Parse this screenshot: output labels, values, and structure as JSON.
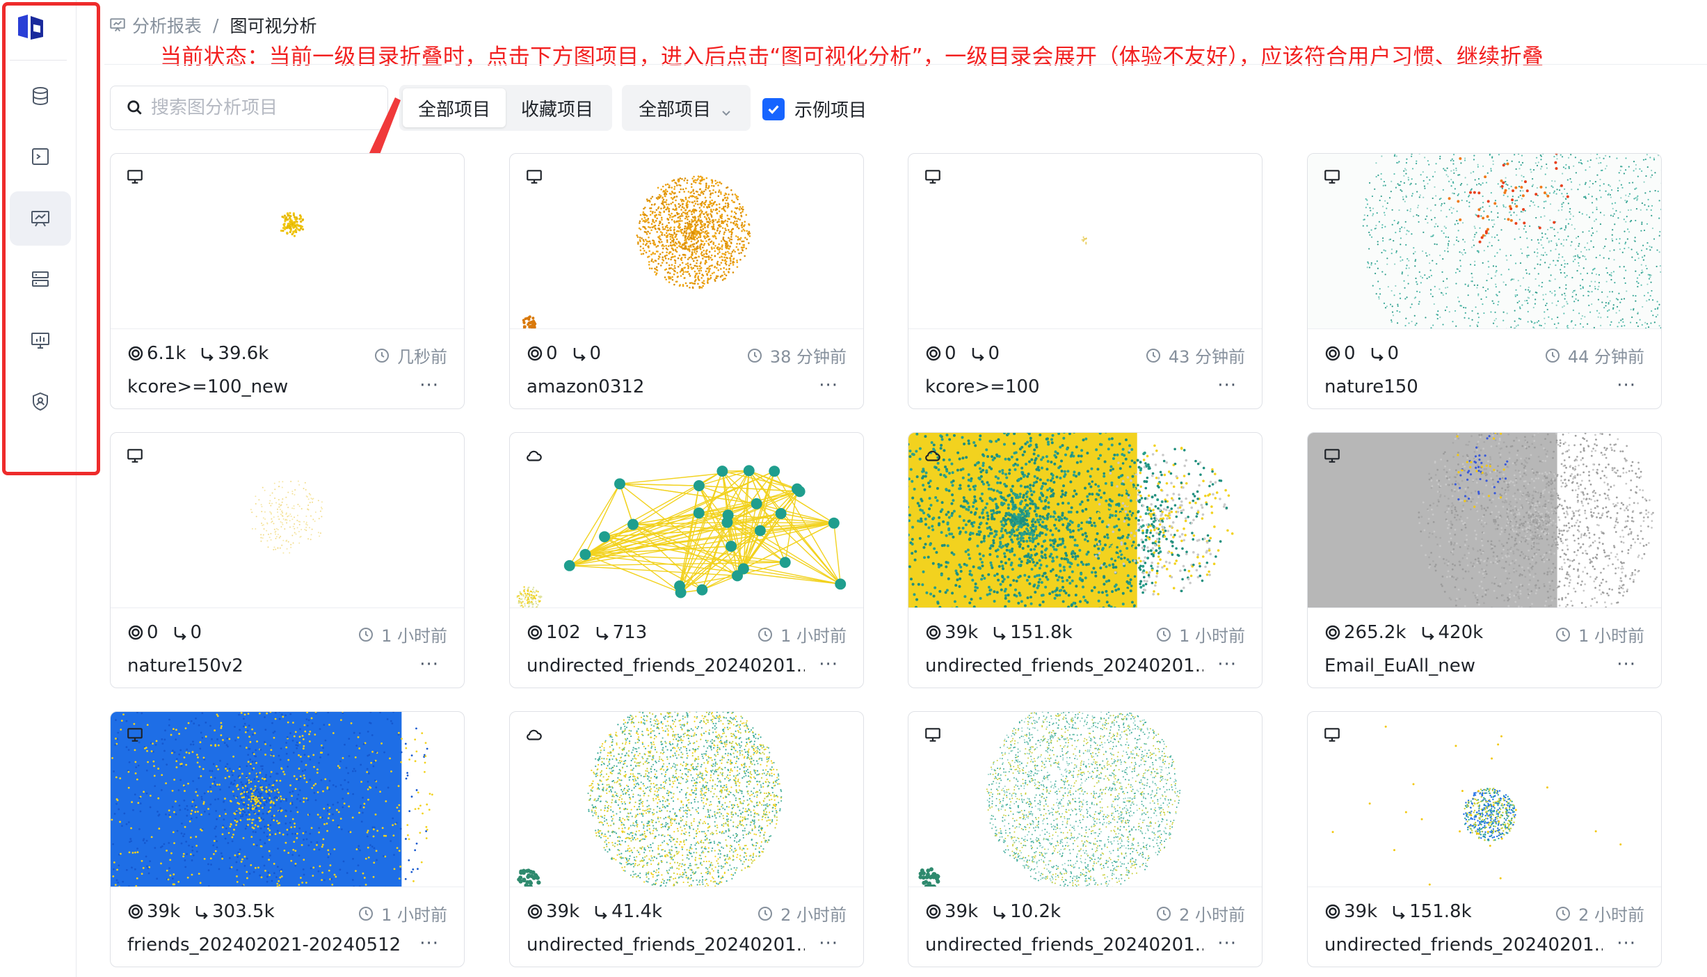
{
  "breadcrumb": {
    "parent": "分析报表",
    "separator": "/",
    "current": "图可视分析"
  },
  "annotation": "当前状态：当前一级目录折叠时，点击下方图项目，进入后点击“图可视化分析”，一级目录会展开（体验不友好），应该符合用户习惯、继续折叠",
  "search": {
    "placeholder": "搜索图分析项目",
    "value": ""
  },
  "segment": {
    "all": "全部项目",
    "favorites": "收藏项目",
    "active": "all"
  },
  "dropdown": {
    "selected": "全部项目"
  },
  "checkbox": {
    "label": "示例项目",
    "checked": true
  },
  "colors": {
    "accent": "#1664ff",
    "annotation": "#f21f1f",
    "active_nav_bg": "#eef0f5"
  },
  "sidebar": {
    "items": [
      {
        "icon": "database-icon",
        "active": false
      },
      {
        "icon": "terminal-icon",
        "active": false
      },
      {
        "icon": "graph-analysis-icon",
        "active": true
      },
      {
        "icon": "server-icon",
        "active": false
      },
      {
        "icon": "monitor-chart-icon",
        "active": false
      },
      {
        "icon": "shield-user-icon",
        "active": false
      }
    ]
  },
  "projects": [
    {
      "name": "kcore>=100_new",
      "nodes": "6.1k",
      "edges": "39.6k",
      "time": "几秒前",
      "type": "desktop",
      "thumb": "yellow-small"
    },
    {
      "name": "amazon0312",
      "nodes": "0",
      "edges": "0",
      "time": "38 分钟前",
      "type": "desktop",
      "thumb": "orange-ball"
    },
    {
      "name": "kcore>=100",
      "nodes": "0",
      "edges": "0",
      "time": "43 分钟前",
      "type": "desktop",
      "thumb": "empty"
    },
    {
      "name": "nature150",
      "nodes": "0",
      "edges": "0",
      "time": "44 分钟前",
      "type": "desktop",
      "thumb": "teal-cloud"
    },
    {
      "name": "nature150v2",
      "nodes": "0",
      "edges": "0",
      "time": "1 小时前",
      "type": "desktop",
      "thumb": "faint"
    },
    {
      "name": "undirected_friends_20240201...",
      "nodes": "102",
      "edges": "713",
      "time": "1 小时前",
      "type": "cloud",
      "thumb": "network"
    },
    {
      "name": "undirected_friends_20240201...",
      "nodes": "39k",
      "edges": "151.8k",
      "time": "1 小时前",
      "type": "cloud",
      "thumb": "dense-yellow"
    },
    {
      "name": "Email_EuAll_new",
      "nodes": "265.2k",
      "edges": "420k",
      "time": "1 小时前",
      "type": "desktop",
      "thumb": "gray"
    },
    {
      "name": "friends_202402021-20240512",
      "nodes": "39k",
      "edges": "303.5k",
      "time": "1 小时前",
      "type": "desktop",
      "thumb": "blue-dense"
    },
    {
      "name": "undirected_friends_20240201...",
      "nodes": "39k",
      "edges": "41.4k",
      "time": "2 小时前",
      "type": "cloud",
      "thumb": "green-sphere"
    },
    {
      "name": "undirected_friends_20240201...",
      "nodes": "39k",
      "edges": "10.2k",
      "time": "2 小时前",
      "type": "desktop",
      "thumb": "teal-sphere"
    },
    {
      "name": "undirected_friends_20240201...",
      "nodes": "39k",
      "edges": "151.8k",
      "time": "2 小时前",
      "type": "desktop",
      "thumb": "small-sphere"
    }
  ],
  "more_label": "···"
}
